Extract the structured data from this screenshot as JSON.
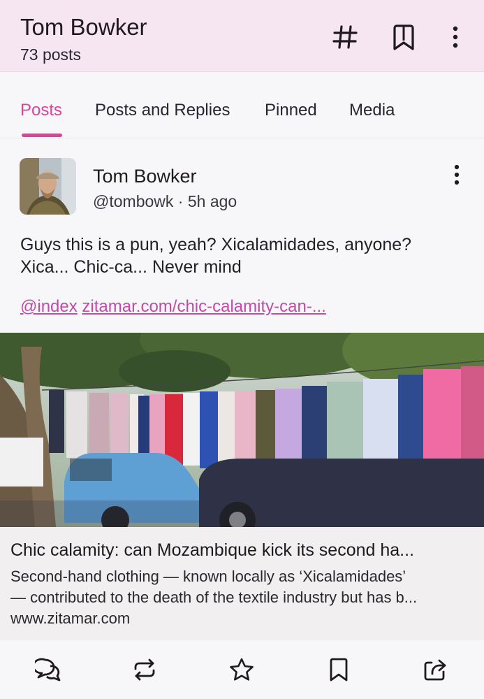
{
  "header": {
    "title": "Tom Bowker",
    "subtitle": "73 posts",
    "icons": [
      "hashtag-icon",
      "bookmarks-icon",
      "more-vertical-icon"
    ]
  },
  "tabs": [
    {
      "label": "Posts",
      "active": true
    },
    {
      "label": "Posts and Replies",
      "active": false
    },
    {
      "label": "Pinned",
      "active": false
    },
    {
      "label": "Media",
      "active": false
    }
  ],
  "post": {
    "author": "Tom Bowker",
    "handle": "@tombowk",
    "separator": "·",
    "time": "5h ago",
    "lines": [
      "Guys this is a pun, yeah? Xicalamidades, anyone?",
      "Xica... Chic-ca... Never mind"
    ],
    "mention": "@index",
    "link_text": "zitamar.com/chic-calamity-can-...",
    "card": {
      "title": "Chic calamity: can Mozambique kick its second ha...",
      "desc_lines": [
        "Second-hand clothing — known locally as ‘Xicalamidades’",
        "— contributed to the death of the textile industry but has b..."
      ],
      "domain": "www.zitamar.com"
    },
    "actions": [
      "reply-icon",
      "boost-icon",
      "favourite-icon",
      "bookmark-icon",
      "share-icon"
    ]
  },
  "colors": {
    "header_bg": "#f6e6f2",
    "accent": "#d9449a",
    "link": "#c24aa8",
    "background": "#f7f6f8"
  }
}
